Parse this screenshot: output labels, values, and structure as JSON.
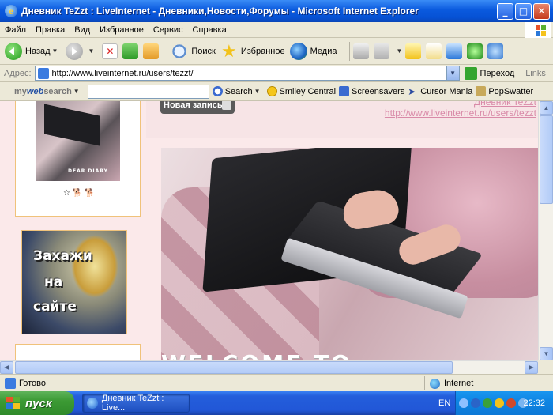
{
  "window": {
    "title": "Дневник TeZzt : LiveInternet - Дневники,Новости,Форумы - Microsoft Internet Explorer",
    "minimize": "_",
    "maximize": "□",
    "close": "✕"
  },
  "menu": [
    "Файл",
    "Правка",
    "Вид",
    "Избранное",
    "Сервис",
    "Справка"
  ],
  "toolbar": {
    "back_label": "Назад",
    "search_label": "Поиск",
    "favorites_label": "Избранное",
    "media_label": "Медиа"
  },
  "address": {
    "label": "Адрес:",
    "url": "http://www.liveinternet.ru/users/tezzt/",
    "go_label": "Переход",
    "links_label": "Links"
  },
  "searchbar": {
    "brand_prefix": "my",
    "brand_bold": "web",
    "brand_suffix": "search",
    "input_value": "",
    "search_label": "Search",
    "smiley_label": "Smiley Central",
    "screensavers_label": "Screensavers",
    "cursor_label": "Cursor Mania",
    "popswatter_label": "PopSwatter"
  },
  "page": {
    "new_post_label": "Новая запись",
    "blog_link_title": "Дневник TeZzt",
    "blog_link_url": "http://www.liveinternet.ru/users/tezzt",
    "avatar_caption": "DEAR DIARY",
    "banner_lines": [
      "Захажи",
      "на",
      "сайте"
    ],
    "welcome_text": "WELCOME TO"
  },
  "status": {
    "text": "Готово",
    "zone": "Internet"
  },
  "taskbar": {
    "start_label": "пуск",
    "task_label": "Дневник TeZzt : Live...",
    "lang": "EN",
    "clock": "22:32"
  },
  "colors": {
    "titlebar": "#0651d4",
    "page_bg": "#f7e4e6",
    "accent_link": "#d98aa8",
    "taskbar": "#245edb",
    "start": "#3c9a34"
  }
}
